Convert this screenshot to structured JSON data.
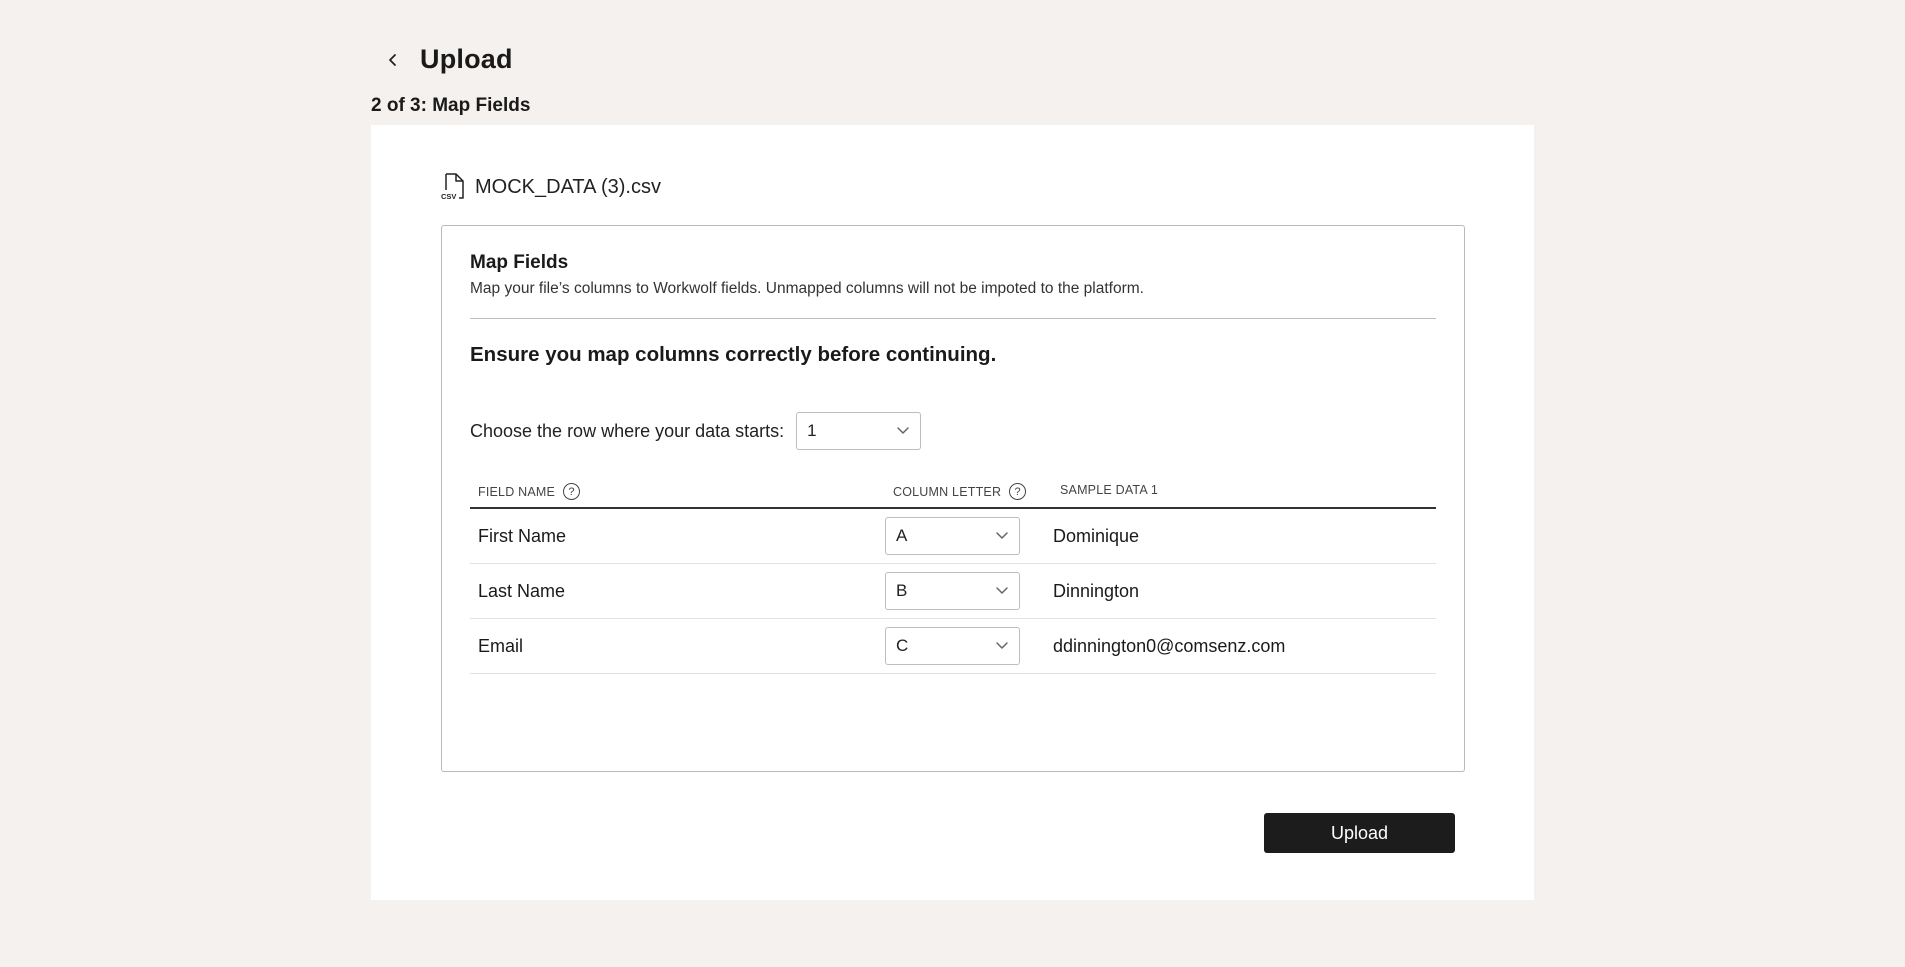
{
  "header": {
    "title": "Upload"
  },
  "step": {
    "label": "2 of 3: Map Fields"
  },
  "file": {
    "name": "MOCK_DATA (3).csv",
    "icon": "csv-file-icon"
  },
  "panel": {
    "title": "Map Fields",
    "description": "Map your file’s columns to Workwolf fields. Unmapped columns will not be impoted to the platform.",
    "warning": "Ensure you map columns correctly before continuing."
  },
  "row_start": {
    "label": "Choose the row where your data starts:",
    "value": "1"
  },
  "table": {
    "headers": {
      "field_name": "FIELD NAME",
      "column_letter": "COLUMN LETTER",
      "sample": "SAMPLE DATA 1"
    },
    "rows": [
      {
        "field": "First Name",
        "column": "A",
        "sample": "Dominique"
      },
      {
        "field": "Last Name",
        "column": "B",
        "sample": "Dinnington"
      },
      {
        "field": "Email",
        "column": "C",
        "sample": "ddinnington0@comsenz.com"
      }
    ]
  },
  "actions": {
    "upload_label": "Upload"
  }
}
